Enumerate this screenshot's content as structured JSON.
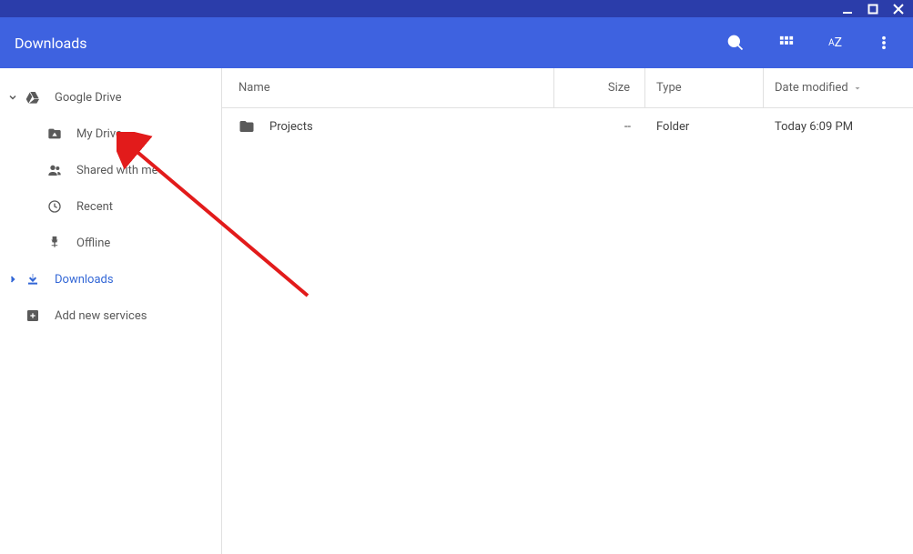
{
  "header": {
    "title": "Downloads"
  },
  "sidebar": {
    "root": {
      "label": "Google Drive"
    },
    "items": [
      {
        "label": "My Drive"
      },
      {
        "label": "Shared with me"
      },
      {
        "label": "Recent"
      },
      {
        "label": "Offline"
      }
    ],
    "downloads": {
      "label": "Downloads"
    },
    "add_services": {
      "label": "Add new services"
    }
  },
  "columns": {
    "name": "Name",
    "size": "Size",
    "type": "Type",
    "date": "Date modified"
  },
  "rows": [
    {
      "name": "Projects",
      "size": "--",
      "type": "Folder",
      "date": "Today 6:09 PM"
    }
  ]
}
